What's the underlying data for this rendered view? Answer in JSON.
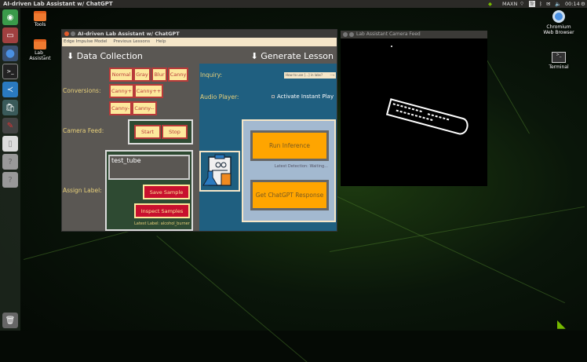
{
  "topbar": {
    "title": "AI-driven Lab Assistant w/ ChatGPT",
    "tray": {
      "power_mode": "MAXN",
      "keyboard": "Tr",
      "time": "00:14"
    }
  },
  "desktop": {
    "icons": [
      {
        "label": "Tools"
      },
      {
        "label": "Lab_\nAssistant"
      },
      {
        "label": "Chromium Web Browser"
      },
      {
        "label": "Terminal"
      }
    ]
  },
  "app": {
    "title": "AI-driven Lab Assistant w/ ChatGPT",
    "menu": [
      "Edge Impulse Model",
      "Previous Lessons",
      "Help"
    ],
    "data_collection": {
      "heading": "⬇ Data Collection",
      "conversions_label": "Conversions:",
      "conversions": [
        "Normal",
        "Gray",
        "Blur",
        "Canny",
        "Canny+",
        "Canny++",
        "Canny-",
        "Canny--"
      ],
      "camera_label": "Camera Feed:",
      "start": "Start",
      "stop": "Stop",
      "assign_label": "Assign Label:",
      "label_value": "test_tube",
      "save": "Save Sample",
      "inspect": "Inspect Samples",
      "latest_label": "Latest Label: alcohol_burner"
    },
    "generate": {
      "heading": "⬇ Generate Lesson",
      "inquiry_label": "Inquiry:",
      "inquiry_value": "How to use [...] in labs?",
      "audio_label": "Audio Player:",
      "instant_play": "Activate Instant Play",
      "instant_play_checked": false,
      "run": "Run Inference",
      "latest_detection": "Latest Detection: Waiting...",
      "chatgpt": "Get ChatGPT Response"
    }
  },
  "camera_window": {
    "title": "Lab Assistant Camera Feed"
  }
}
